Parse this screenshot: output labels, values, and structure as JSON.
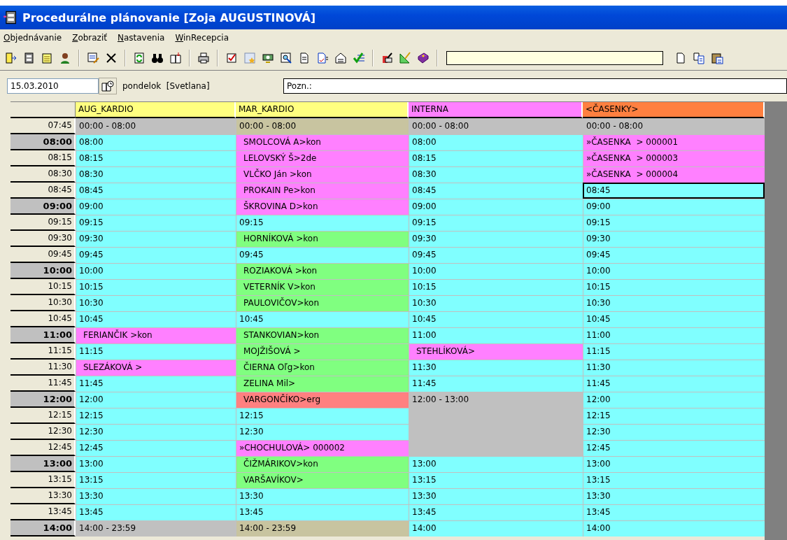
{
  "window": {
    "title": "Procedurálne plánovanie [Zoja AUGUSTINOVÁ]"
  },
  "menu": [
    "Objednávanie",
    "Zobraziť",
    "Nastavenia",
    "WinRecepcia"
  ],
  "date_bar": {
    "date": "15.03.2010",
    "day": "pondelok  [Svetlana]",
    "note": "Pozn.:"
  },
  "columns": [
    {
      "name": "AUG_KARDIO",
      "color": "#ffff80"
    },
    {
      "name": "MAR_KARDIO",
      "color": "#ffff80"
    },
    {
      "name": "INTERNA",
      "color": "#ff80ff"
    },
    {
      "name": "<ČASENKY>",
      "color": "#ff8040"
    }
  ],
  "rows": [
    {
      "time": "07:45",
      "kind": "quarter",
      "cells": [
        {
          "text": "00:00 - 08:00",
          "kind": "closed",
          "selected": false
        },
        {
          "text": "00:00 - 08:00",
          "kind": "off",
          "selected": false
        },
        {
          "text": "00:00 - 08:00",
          "kind": "closed",
          "selected": false
        },
        {
          "text": "00:00 - 08:00",
          "kind": "closed",
          "selected": false
        }
      ]
    },
    {
      "time": "08:00",
      "kind": "hour",
      "cells": [
        {
          "text": "08:00",
          "kind": "free",
          "selected": false
        },
        {
          "text": "SMOLCOVÁ A>kon",
          "kind": "reserved",
          "selected": false
        },
        {
          "text": "08:00",
          "kind": "free",
          "selected": false
        },
        {
          "text": "»ČASENKA  > 000001",
          "kind": "ticket",
          "selected": false
        }
      ]
    },
    {
      "time": "08:15",
      "kind": "quarter",
      "cells": [
        {
          "text": "08:15",
          "kind": "free",
          "selected": false
        },
        {
          "text": "LELOVSKÝ Š>2de",
          "kind": "reserved",
          "selected": false
        },
        {
          "text": "08:15",
          "kind": "free",
          "selected": false
        },
        {
          "text": "»ČASENKA  > 000003",
          "kind": "ticket",
          "selected": false
        }
      ]
    },
    {
      "time": "08:30",
      "kind": "quarter",
      "cells": [
        {
          "text": "08:30",
          "kind": "free",
          "selected": false
        },
        {
          "text": "VLČKO Ján >kon",
          "kind": "reserved",
          "selected": false
        },
        {
          "text": "08:30",
          "kind": "free",
          "selected": false
        },
        {
          "text": "»ČASENKA  > 000004",
          "kind": "ticket",
          "selected": false
        }
      ]
    },
    {
      "time": "08:45",
      "kind": "quarter",
      "cells": [
        {
          "text": "08:45",
          "kind": "free",
          "selected": false
        },
        {
          "text": "PROKAIN Pe>kon",
          "kind": "reserved",
          "selected": false
        },
        {
          "text": "08:45",
          "kind": "free",
          "selected": false
        },
        {
          "text": "08:45",
          "kind": "free",
          "selected": true
        }
      ]
    },
    {
      "time": "09:00",
      "kind": "hour",
      "cells": [
        {
          "text": "09:00",
          "kind": "free",
          "selected": false
        },
        {
          "text": "ŠKROVINA D>kon",
          "kind": "reserved",
          "selected": false
        },
        {
          "text": "09:00",
          "kind": "free",
          "selected": false
        },
        {
          "text": "09:00",
          "kind": "free",
          "selected": false
        }
      ]
    },
    {
      "time": "09:15",
      "kind": "quarter",
      "cells": [
        {
          "text": "09:15",
          "kind": "free",
          "selected": false
        },
        {
          "text": "09:15",
          "kind": "free",
          "selected": false
        },
        {
          "text": "09:15",
          "kind": "free",
          "selected": false
        },
        {
          "text": "09:15",
          "kind": "free",
          "selected": false
        }
      ]
    },
    {
      "time": "09:30",
      "kind": "quarter",
      "cells": [
        {
          "text": "09:30",
          "kind": "free",
          "selected": false
        },
        {
          "text": "HORNÍKOVÁ >kon",
          "kind": "confirmed",
          "selected": false
        },
        {
          "text": "09:30",
          "kind": "free",
          "selected": false
        },
        {
          "text": "09:30",
          "kind": "free",
          "selected": false
        }
      ]
    },
    {
      "time": "09:45",
      "kind": "quarter",
      "cells": [
        {
          "text": "09:45",
          "kind": "free",
          "selected": false
        },
        {
          "text": "09:45",
          "kind": "free",
          "selected": false
        },
        {
          "text": "09:45",
          "kind": "free",
          "selected": false
        },
        {
          "text": "09:45",
          "kind": "free",
          "selected": false
        }
      ]
    },
    {
      "time": "10:00",
      "kind": "hour",
      "cells": [
        {
          "text": "10:00",
          "kind": "free",
          "selected": false
        },
        {
          "text": "ROZIAKOVÁ >kon",
          "kind": "confirmed",
          "selected": false
        },
        {
          "text": "10:00",
          "kind": "free",
          "selected": false
        },
        {
          "text": "10:00",
          "kind": "free",
          "selected": false
        }
      ]
    },
    {
      "time": "10:15",
      "kind": "quarter",
      "cells": [
        {
          "text": "10:15",
          "kind": "free",
          "selected": false
        },
        {
          "text": "VETERNÍK V>kon",
          "kind": "confirmed",
          "selected": false
        },
        {
          "text": "10:15",
          "kind": "free",
          "selected": false
        },
        {
          "text": "10:15",
          "kind": "free",
          "selected": false
        }
      ]
    },
    {
      "time": "10:30",
      "kind": "quarter",
      "cells": [
        {
          "text": "10:30",
          "kind": "free",
          "selected": false
        },
        {
          "text": "PAULOVIČOV>kon",
          "kind": "confirmed",
          "selected": false
        },
        {
          "text": "10:30",
          "kind": "free",
          "selected": false
        },
        {
          "text": "10:30",
          "kind": "free",
          "selected": false
        }
      ]
    },
    {
      "time": "10:45",
      "kind": "quarter",
      "cells": [
        {
          "text": "10:45",
          "kind": "free",
          "selected": false
        },
        {
          "text": "10:45",
          "kind": "free",
          "selected": false
        },
        {
          "text": "10:45",
          "kind": "free",
          "selected": false
        },
        {
          "text": "10:45",
          "kind": "free",
          "selected": false
        }
      ]
    },
    {
      "time": "11:00",
      "kind": "hour",
      "cells": [
        {
          "text": "FERIANČIK >kon",
          "kind": "reserved",
          "selected": false
        },
        {
          "text": "STANKOVIAN>kon",
          "kind": "confirmed",
          "selected": false
        },
        {
          "text": "11:00",
          "kind": "free",
          "selected": false
        },
        {
          "text": "11:00",
          "kind": "free",
          "selected": false
        }
      ]
    },
    {
      "time": "11:15",
      "kind": "quarter",
      "cells": [
        {
          "text": "11:15",
          "kind": "free",
          "selected": false
        },
        {
          "text": "MOJŽIŠOVÁ >",
          "kind": "confirmed",
          "selected": false
        },
        {
          "text": "STEHLÍKOVÁ>",
          "kind": "reserved",
          "selected": false
        },
        {
          "text": "11:15",
          "kind": "free",
          "selected": false
        }
      ]
    },
    {
      "time": "11:30",
      "kind": "quarter",
      "cells": [
        {
          "text": "SLEZÁKOVÁ >",
          "kind": "reserved",
          "selected": false
        },
        {
          "text": "ČIERNA Oľg>kon",
          "kind": "confirmed",
          "selected": false
        },
        {
          "text": "11:30",
          "kind": "free",
          "selected": false
        },
        {
          "text": "11:30",
          "kind": "free",
          "selected": false
        }
      ]
    },
    {
      "time": "11:45",
      "kind": "quarter",
      "cells": [
        {
          "text": "11:45",
          "kind": "free",
          "selected": false
        },
        {
          "text": "ZELINA Mil>",
          "kind": "confirmed",
          "selected": false
        },
        {
          "text": "11:45",
          "kind": "free",
          "selected": false
        },
        {
          "text": "11:45",
          "kind": "free",
          "selected": false
        }
      ]
    },
    {
      "time": "12:00",
      "kind": "hour",
      "cells": [
        {
          "text": "12:00",
          "kind": "free",
          "selected": false
        },
        {
          "text": "VARGONČÍKO>erg",
          "kind": "urgent",
          "selected": false
        },
        {
          "text": "12:00 - 13:00",
          "kind": "closed",
          "selected": false
        },
        {
          "text": "12:00",
          "kind": "free",
          "selected": false
        }
      ]
    },
    {
      "time": "12:15",
      "kind": "quarter",
      "cells": [
        {
          "text": "12:15",
          "kind": "free",
          "selected": false
        },
        {
          "text": "12:15",
          "kind": "free",
          "selected": false
        },
        {
          "kind": "closed",
          "selected": false
        },
        {
          "text": "12:15",
          "kind": "free",
          "selected": false
        }
      ]
    },
    {
      "time": "12:30",
      "kind": "quarter",
      "cells": [
        {
          "text": "12:30",
          "kind": "free",
          "selected": false
        },
        {
          "text": "12:30",
          "kind": "free",
          "selected": false
        },
        {
          "kind": "closed",
          "selected": false
        },
        {
          "text": "12:30",
          "kind": "free",
          "selected": false
        }
      ]
    },
    {
      "time": "12:45",
      "kind": "quarter",
      "cells": [
        {
          "text": "12:45",
          "kind": "free",
          "selected": false
        },
        {
          "text": "»CHOCHULOVÁ> 000002",
          "kind": "ticket",
          "selected": false
        },
        {
          "kind": "closed",
          "selected": false
        },
        {
          "text": "12:45",
          "kind": "free",
          "selected": false
        }
      ]
    },
    {
      "time": "13:00",
      "kind": "hour",
      "cells": [
        {
          "text": "13:00",
          "kind": "free",
          "selected": false
        },
        {
          "text": "ČIŽMÁRIKOV>kon",
          "kind": "confirmed",
          "selected": false
        },
        {
          "text": "13:00",
          "kind": "free",
          "selected": false
        },
        {
          "text": "13:00",
          "kind": "free",
          "selected": false
        }
      ]
    },
    {
      "time": "13:15",
      "kind": "quarter",
      "cells": [
        {
          "text": "13:15",
          "kind": "free",
          "selected": false
        },
        {
          "text": "VARŠAVÍKOV>",
          "kind": "confirmed",
          "selected": false
        },
        {
          "text": "13:15",
          "kind": "free",
          "selected": false
        },
        {
          "text": "13:15",
          "kind": "free",
          "selected": false
        }
      ]
    },
    {
      "time": "13:30",
      "kind": "quarter",
      "cells": [
        {
          "text": "13:30",
          "kind": "free",
          "selected": false
        },
        {
          "text": "13:30",
          "kind": "free",
          "selected": false
        },
        {
          "text": "13:30",
          "kind": "free",
          "selected": false
        },
        {
          "text": "13:30",
          "kind": "free",
          "selected": false
        }
      ]
    },
    {
      "time": "13:45",
      "kind": "quarter",
      "cells": [
        {
          "text": "13:45",
          "kind": "free",
          "selected": false
        },
        {
          "text": "13:45",
          "kind": "free",
          "selected": false
        },
        {
          "text": "13:45",
          "kind": "free",
          "selected": false
        },
        {
          "text": "13:45",
          "kind": "free",
          "selected": false
        }
      ]
    },
    {
      "time": "14:00",
      "kind": "hour",
      "cells": [
        {
          "text": "14:00 - 23:59",
          "kind": "closed",
          "selected": false
        },
        {
          "text": "14:00 - 23:59",
          "kind": "off",
          "selected": false
        },
        {
          "text": "14:00",
          "kind": "free",
          "selected": false
        },
        {
          "text": "14:00",
          "kind": "free",
          "selected": false
        }
      ]
    }
  ]
}
